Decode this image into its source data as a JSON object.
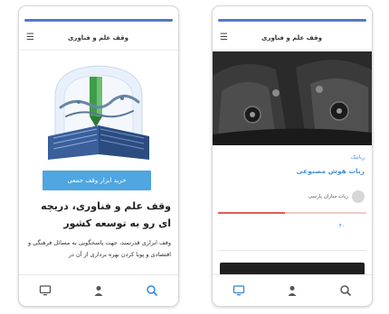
{
  "left_screen": {
    "header_title": "وقف علم و فناوری",
    "buy_button": "خرید ابزار وقف جمعی",
    "headline": "وقف علم و فناوری، دریچه ای رو به توسعه کشور",
    "body_text": "وقف ابزاری قدرتمند، جهت پاسخگویی به مسائل فرهنگی و اقتصادی و پویا کردن بهره برداری از آن در",
    "logo_text": "وقف علم و فناوری",
    "nav": {
      "video_label": "",
      "user_label": "",
      "search_label": ""
    }
  },
  "right_screen": {
    "header_title": "وقف علم و فناوری",
    "category": "رباتیک",
    "course_title": "ربات هوش مصنوعی",
    "instructor_name": "ربات سازان پارسی",
    "progress_fraction": 0.45,
    "stats": [
      {
        "value": "۴۰",
        "label": ""
      },
      {
        "value": "",
        "label": ""
      },
      {
        "value": "",
        "label": ""
      }
    ],
    "nav": {
      "video_label": "",
      "user_label": "",
      "search_label": ""
    }
  },
  "colors": {
    "accent": "#4fa6e0",
    "status_bar": "#5577c6",
    "progress": "#e05a5a",
    "link": "#4a90d6"
  }
}
